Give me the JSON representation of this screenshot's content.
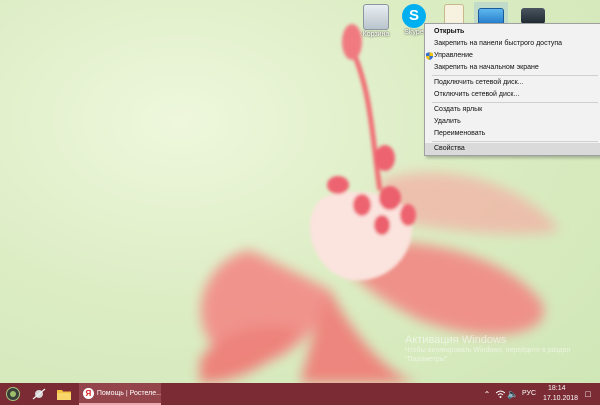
{
  "desktop": {
    "icons": [
      {
        "label": "Корзина"
      },
      {
        "label": "Skype"
      },
      {
        "label": ""
      },
      {
        "label": ""
      },
      {
        "label": ""
      }
    ]
  },
  "context_menu": {
    "items": [
      {
        "label": "Открыть",
        "bold": true
      },
      {
        "label": "Закрепить на панели быстрого доступа"
      },
      {
        "label": "Управление",
        "icon": "shield-icon"
      },
      {
        "label": "Закрепить на начальном экране"
      },
      {
        "label": "Подключить сетевой диск..."
      },
      {
        "label": "Отключить сетевой диск..."
      },
      {
        "label": "Создать ярлык"
      },
      {
        "label": "Удалить"
      },
      {
        "label": "Переименовать"
      },
      {
        "label": "Свойства",
        "highlighted": true
      }
    ]
  },
  "watermark": {
    "title": "Активация Windows",
    "text": "Чтобы активировать Windows, перейдите в раздел \"Параметры\"."
  },
  "taskbar": {
    "active_task_label": "Помощь | Ростеле...",
    "language": "РУС",
    "time": "18:14",
    "date": "17.10.2018",
    "colors": {
      "background": "#7a2b33",
      "active": "#94454c"
    }
  }
}
